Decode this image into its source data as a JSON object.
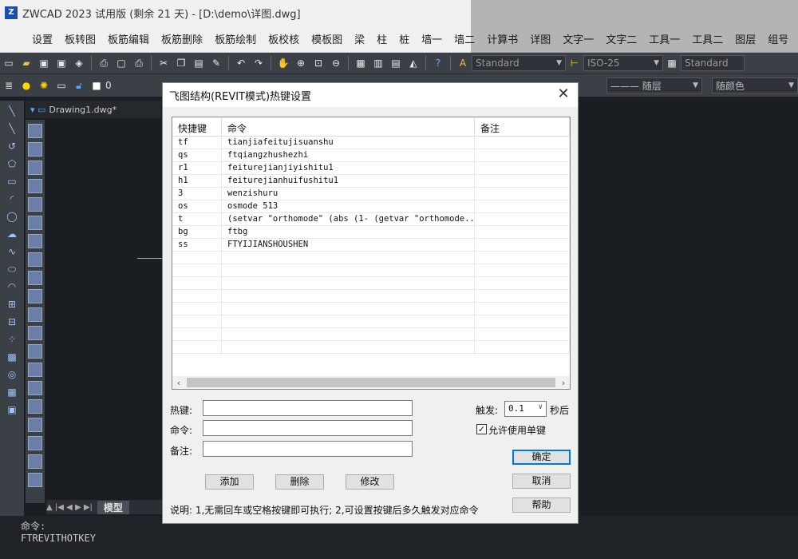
{
  "app": {
    "title": "ZWCAD 2023 试用版 (剩余 21 天) - [D:\\demo\\详图.dwg]",
    "icon": "zwcad-logo-icon"
  },
  "menu": [
    "设置",
    "板转图",
    "板筋编辑",
    "板筋删除",
    "板筋绘制",
    "板校核",
    "模板图",
    "梁",
    "柱",
    "桩",
    "墙一",
    "墙二",
    "计算书",
    "详图",
    "文字一",
    "文字二",
    "工具一",
    "工具二",
    "图层",
    "组号"
  ],
  "toolbar": {
    "text_style": "Standard",
    "dim_style": "ISO-25",
    "table_style": "Standard",
    "layer_value": "0",
    "linetype": "——— 随层",
    "color": "随颜色",
    "hidden_layer_label": "随层"
  },
  "doc_tab": "Drawing1.dwg*",
  "model_tab": "模型",
  "command": {
    "line1": "命令:",
    "line2": "FTREVITHOTKEY"
  },
  "dialog": {
    "title": "飞图结构(REVIT模式)热键设置",
    "columns": [
      "快捷键",
      "命令",
      "备注"
    ],
    "rows": [
      {
        "key": "tf",
        "cmd": "tianjiafeitujisuanshu",
        "note": ""
      },
      {
        "key": "qs",
        "cmd": "ftqiangzhushezhi",
        "note": ""
      },
      {
        "key": "r1",
        "cmd": "feiturejianjiyishitu1",
        "note": ""
      },
      {
        "key": "h1",
        "cmd": "feiturejianhuifushitu1",
        "note": ""
      },
      {
        "key": "3",
        "cmd": "wenzishuru",
        "note": ""
      },
      {
        "key": "os",
        "cmd": "osmode 513",
        "note": ""
      },
      {
        "key": "t",
        "cmd": "(setvar \"orthomode\" (abs (1- (getvar \"orthomode...",
        "note": ""
      },
      {
        "key": "bg",
        "cmd": "ftbg",
        "note": ""
      },
      {
        "key": "ss",
        "cmd": "FTYIJIANSHOUSHEN",
        "note": ""
      }
    ],
    "labels": {
      "hotkey": "热键:",
      "command": "命令:",
      "note": "备注:",
      "trigger": "触发:",
      "seconds_after": "秒后",
      "allow_single": "允许使用单键"
    },
    "trigger_value": "0.1",
    "allow_single_checked": true,
    "buttons": {
      "add": "添加",
      "delete": "删除",
      "modify": "修改",
      "ok": "确定",
      "cancel": "取消",
      "help": "帮助"
    },
    "note_text": "说明: 1,无需回车或空格按键即可执行; 2,可设置按键后多久触发对应命令"
  }
}
